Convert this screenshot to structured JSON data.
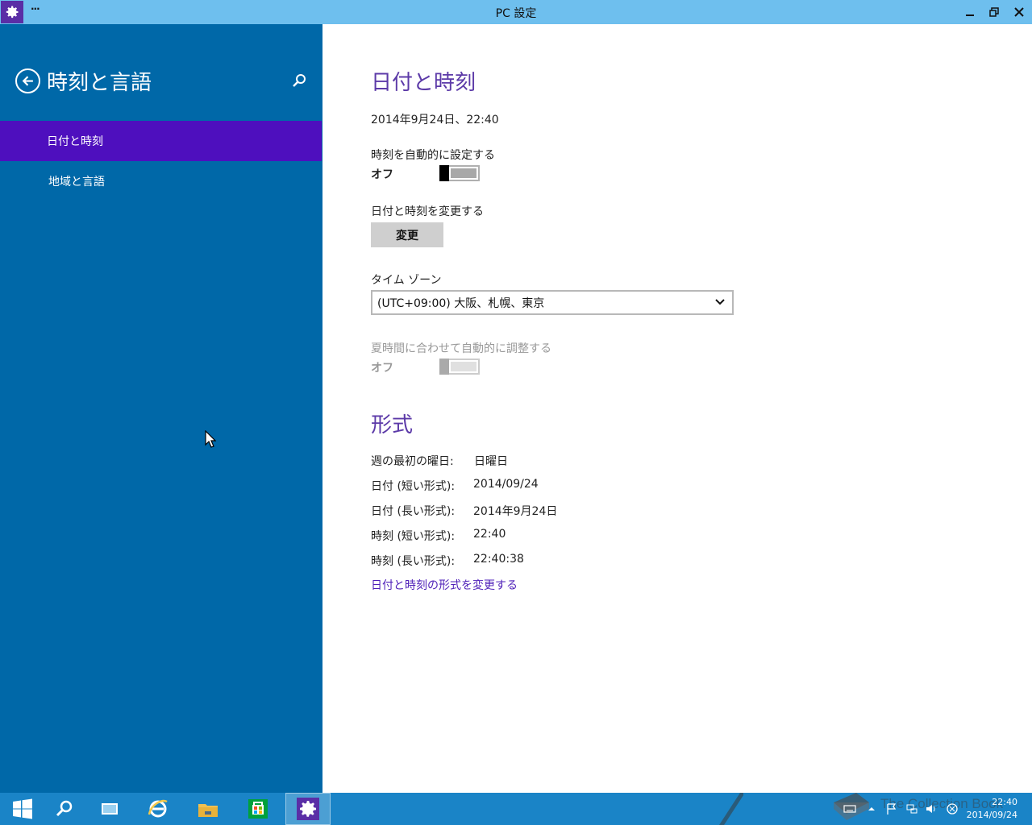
{
  "window": {
    "title": "PC 設定",
    "menu_dots": "···",
    "icon": "settings-gear-icon",
    "controls": {
      "minimize": "minimize-icon",
      "maximize": "restore-icon",
      "close": "close-icon"
    }
  },
  "sidebar": {
    "title": "時刻と言語",
    "back_icon": "back-arrow-icon",
    "search_icon": "search-icon",
    "items": [
      {
        "label": "日付と時刻",
        "selected": true
      },
      {
        "label": "地域と言語",
        "selected": false
      }
    ],
    "bg_color": "#0068a8",
    "selected_color": "#4e0fbe"
  },
  "main": {
    "date_time": {
      "heading": "日付と時刻",
      "current": "2014年9月24日、22:40",
      "auto_set_label": "時刻を自動的に設定する",
      "auto_set_state": "オフ",
      "change_label": "日付と時刻を変更する",
      "change_button": "変更",
      "timezone_label": "タイム ゾーン",
      "timezone_value": "(UTC+09:00) 大阪、札幌、東京",
      "dst_label": "夏時間に合わせて自動的に調整する",
      "dst_state": "オフ"
    },
    "format": {
      "heading": "形式",
      "rows": [
        {
          "label": "週の最初の曜日:",
          "value": "日曜日"
        },
        {
          "label": "日付 (短い形式):",
          "value": "2014/09/24"
        },
        {
          "label": "日付 (長い形式):",
          "value": "2014年9月24日"
        },
        {
          "label": "時刻 (短い形式):",
          "value": "22:40"
        },
        {
          "label": "時刻 (長い形式):",
          "value": "22:40:38"
        }
      ],
      "change_link": "日付と時刻の形式を変更する"
    },
    "accent_color": "#5c3aa8"
  },
  "taskbar": {
    "buttons": [
      "windows-start-icon",
      "search-icon",
      "task-view-icon",
      "internet-explorer-icon",
      "file-explorer-icon",
      "store-icon",
      "settings-gear-icon"
    ],
    "tray": {
      "time": "22:40",
      "date": "2014/09/24",
      "watermark": "The Collection Book"
    }
  }
}
